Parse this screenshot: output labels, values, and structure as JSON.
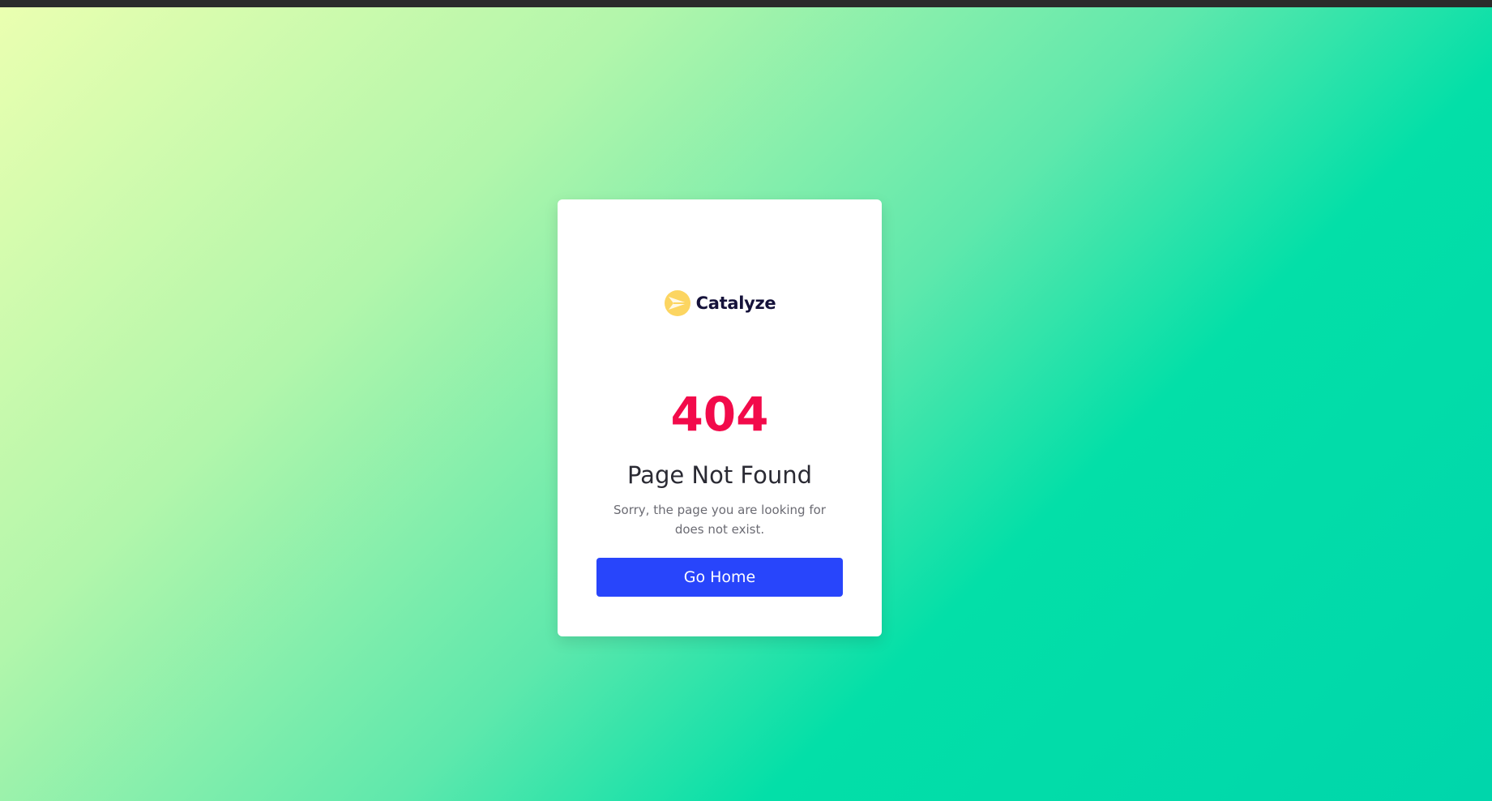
{
  "brand": {
    "name": "Catalyze",
    "logo_icon": "catalyze-logo-icon",
    "accent": "#fcd561",
    "text_color": "#15123a"
  },
  "error": {
    "code": "404",
    "title": "Page Not Found",
    "message": "Sorry, the page you are looking for does not exist.",
    "code_color": "#f20a4a"
  },
  "actions": {
    "home_label": "Go Home",
    "button_color": "#2845fb"
  }
}
